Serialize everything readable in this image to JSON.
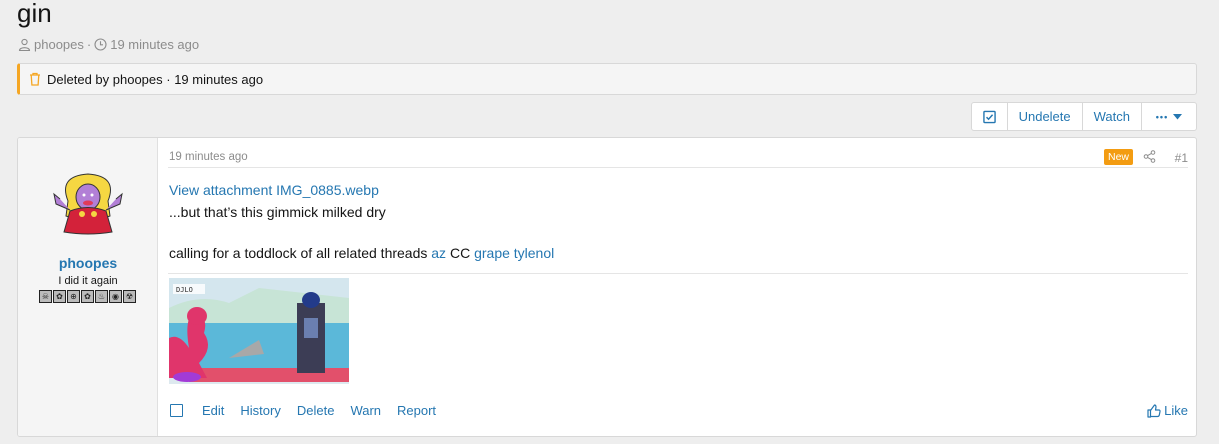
{
  "thread": {
    "title": "gin",
    "author": "phoopes",
    "time": "19 minutes ago",
    "sep": "·"
  },
  "notice": {
    "text": "Deleted by phoopes · 19 minutes ago"
  },
  "toolbar": {
    "undelete_label": "Undelete",
    "watch_label": "Watch",
    "more_label": "•••"
  },
  "post": {
    "user": {
      "name": "phoopes",
      "title": "I did it again",
      "badges": [
        "☠",
        "✿",
        "⊕",
        "✿",
        "♨",
        "◉",
        "☢"
      ]
    },
    "time": "19 minutes ago",
    "new_badge": "New",
    "number": "#1",
    "attachment_link": "View attachment IMG_0885.webp",
    "line2": "...but that’s this gimmick milked dry",
    "line3_prefix": "calling for a toddlock of all related threads",
    "mention1": "az",
    "mention_mid": "CC",
    "mention2": "grape tylenol",
    "image_tag": "DJLO",
    "actions": [
      "Edit",
      "History",
      "Delete",
      "Warn",
      "Report"
    ],
    "like_label": "Like"
  },
  "colors": {
    "link": "#2577b1",
    "notice_accent": "#f5a623",
    "new_badge": "#f39c12"
  }
}
